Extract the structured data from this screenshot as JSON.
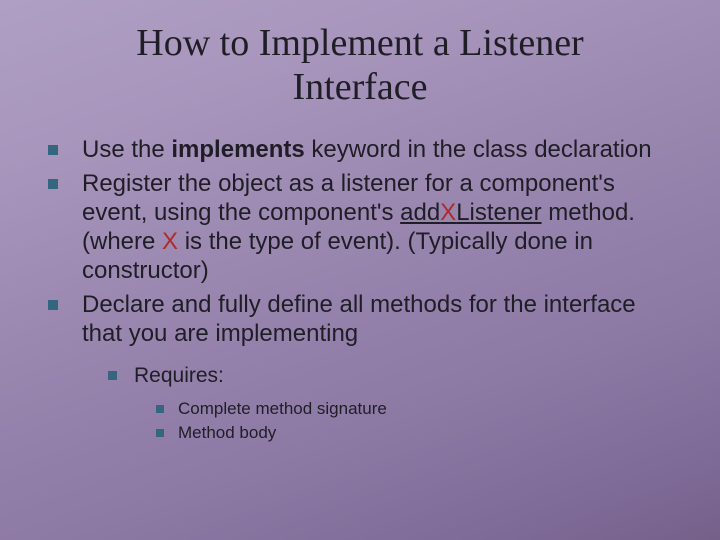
{
  "title_line1": "How to Implement a Listener",
  "title_line2": "Interface",
  "bullets": {
    "b1_pre": "Use the ",
    "b1_kw": "implements",
    "b1_post": " keyword in the class declaration",
    "b2_pre": "Register the object as a listener for a component's event, using the component's ",
    "b2_add": "add",
    "b2_x1": "X",
    "b2_listener": "Listener",
    "b2_mid": " method. (where ",
    "b2_x2": "X",
    "b2_post": " is the type of event). (Typically done in constructor)",
    "b3": "Declare and fully define all methods for the interface that you are implementing",
    "req": "Requires:",
    "req1": "Complete method signature",
    "req2": "Method body"
  }
}
